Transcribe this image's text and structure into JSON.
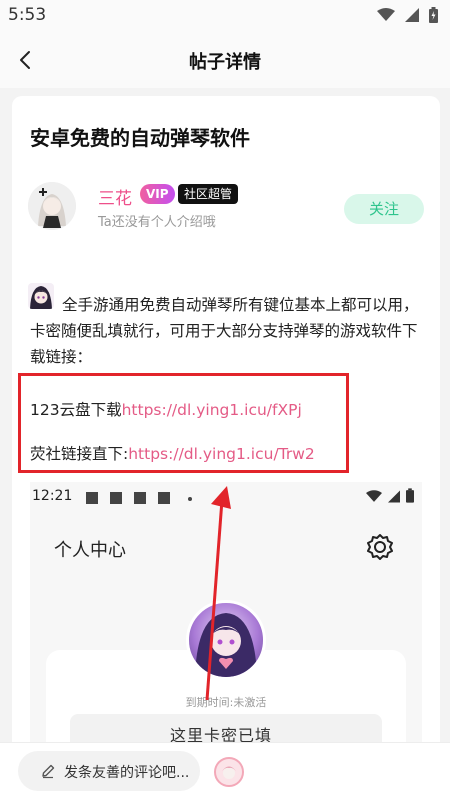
{
  "status_bar": {
    "time": "5:53"
  },
  "nav": {
    "title": "帖子详情"
  },
  "post": {
    "title": "安卓免费的自动弹琴软件",
    "author": {
      "name": "三花",
      "vip_badge": "VIP",
      "role_badge": "社区超管",
      "bio": "Ta还没有个人介绍哦"
    },
    "follow_label": "关注",
    "body": "全手游通用免费自动弹琴所有键位基本上都可以用，卡密随便乱填就行，可用于大部分支持弹琴的游戏软件下载链接：",
    "links": [
      {
        "label": "123云盘下载",
        "url": "https://dl.ying1.icu/fXPj"
      },
      {
        "label": "荧社链接直下:",
        "url": "https://dl.ying1.icu/Trw2"
      }
    ]
  },
  "screenshot": {
    "time": "12:21",
    "title": "个人中心",
    "expire_text": "到期时间:未激活",
    "card_text": "这里卡密已填"
  },
  "bottom_bar": {
    "comment_placeholder": "发条友善的评论吧..."
  },
  "colors": {
    "accent_pink": "#e45b86",
    "follow_green": "#2fc48d",
    "highlight_red": "#e2242a"
  }
}
